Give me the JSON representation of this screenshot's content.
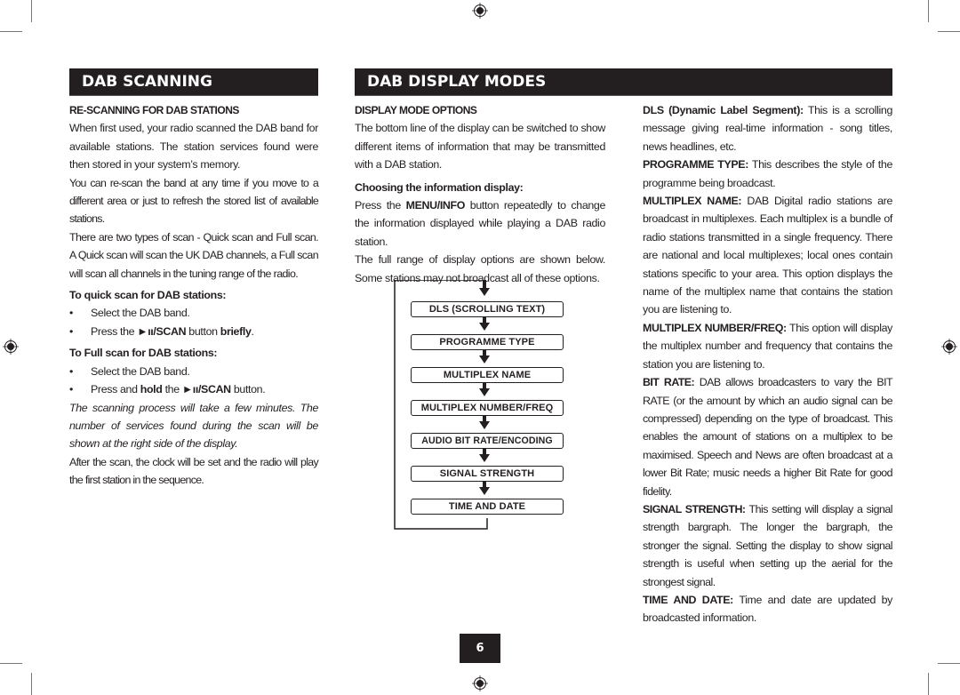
{
  "left": {
    "header": "DAB SCANNING",
    "subheading": "RE-SCANNING FOR DAB STATIONS",
    "para1": "When first used, your radio scanned the DAB band for available stations. The station services found were then stored in your system’s memory.",
    "para2": "You can re-scan the band at any time if you move to a different area or just to refresh the stored list of available stations.",
    "para3": "There are two types of scan - Quick scan and Full scan. A Quick scan will scan the UK DAB channels, a Full scan will scan all channels in the tuning range of the radio.",
    "quick": {
      "heading": "To quick scan for DAB stations:",
      "step1": "Select the DAB band.",
      "step2_pre": "Press the ",
      "step2_btn": "►ıı/SCAN",
      "step2_mid": " button ",
      "step2_bold": "briefly",
      "step2_end": "."
    },
    "full": {
      "heading": "To Full scan for DAB stations:",
      "step1": "Select the DAB band.",
      "step2_pre": "Press and ",
      "step2_bold": "hold",
      "step2_mid": " the ",
      "step2_btn": "►ıı/SCAN",
      "step2_end": " button."
    },
    "bullet": "•",
    "note": "The scanning process will take a few minutes. The number of services found during the scan will be shown at the right side of the display.",
    "para4": "After the scan, the clock will be set and the radio will play the first station in the sequence."
  },
  "middle": {
    "header": "DAB DISPLAY MODES",
    "subheading": "DISPLAY MODE OPTIONS",
    "para1": "The bottom line of the display can be switched to show different items of information that may be transmitted with a DAB station.",
    "choosing_heading": "Choosing the information display:",
    "para2_pre": "Press the ",
    "para2_btn": "MENU/INFO",
    "para2_end": " button repeatedly to change the information displayed while playing a DAB radio station.",
    "para3": "The full range of display options are shown below. Some stations may not broadcast all of these options.",
    "flow": [
      "DLS (SCROLLING TEXT)",
      "PROGRAMME TYPE",
      "MULTIPLEX NAME",
      "MULTIPLEX NUMBER/FREQ",
      "AUDIO BIT RATE/ENCODING",
      "SIGNAL STRENGTH",
      "TIME AND DATE"
    ]
  },
  "right": {
    "items": [
      {
        "term": "DLS (Dynamic Label Segment):",
        "text": " This is a scrolling message giving real-time information - song titles, news headlines, etc."
      },
      {
        "term": "PROGRAMME TYPE:",
        "text": " This describes the style of the programme being broadcast."
      },
      {
        "term": "MULTIPLEX NAME:",
        "text": " DAB Digital radio stations are broadcast in multiplexes. Each multiplex is a bundle of radio stations transmitted in a single frequency. There are national and local multiplexes; local ones contain stations specific to your area. This option displays the name of the multiplex name that contains the station you are listening to."
      },
      {
        "term": "MULTIPLEX NUMBER/FREQ:",
        "text": " This option will display the multiplex number and frequency that contains the station you are listening to."
      },
      {
        "term": "BIT RATE:",
        "text": " DAB allows broadcasters to vary the BIT RATE (or the amount by which an audio signal can be compressed) depending on the type of broadcast. This enables the amount of stations on a multiplex to be maximised. Speech and News are often broadcast at a lower Bit Rate; music needs a higher Bit Rate for good fidelity."
      },
      {
        "term": "SIGNAL STRENGTH:",
        "text": " This setting will display a signal strength bargraph. The longer the bargraph, the stronger the signal. Setting the display to show signal strength is useful when setting up the aerial for the strongest signal."
      },
      {
        "term": "TIME AND DATE:",
        "text": " Time and date are updated by broadcasted information."
      }
    ]
  },
  "page_number": "6"
}
